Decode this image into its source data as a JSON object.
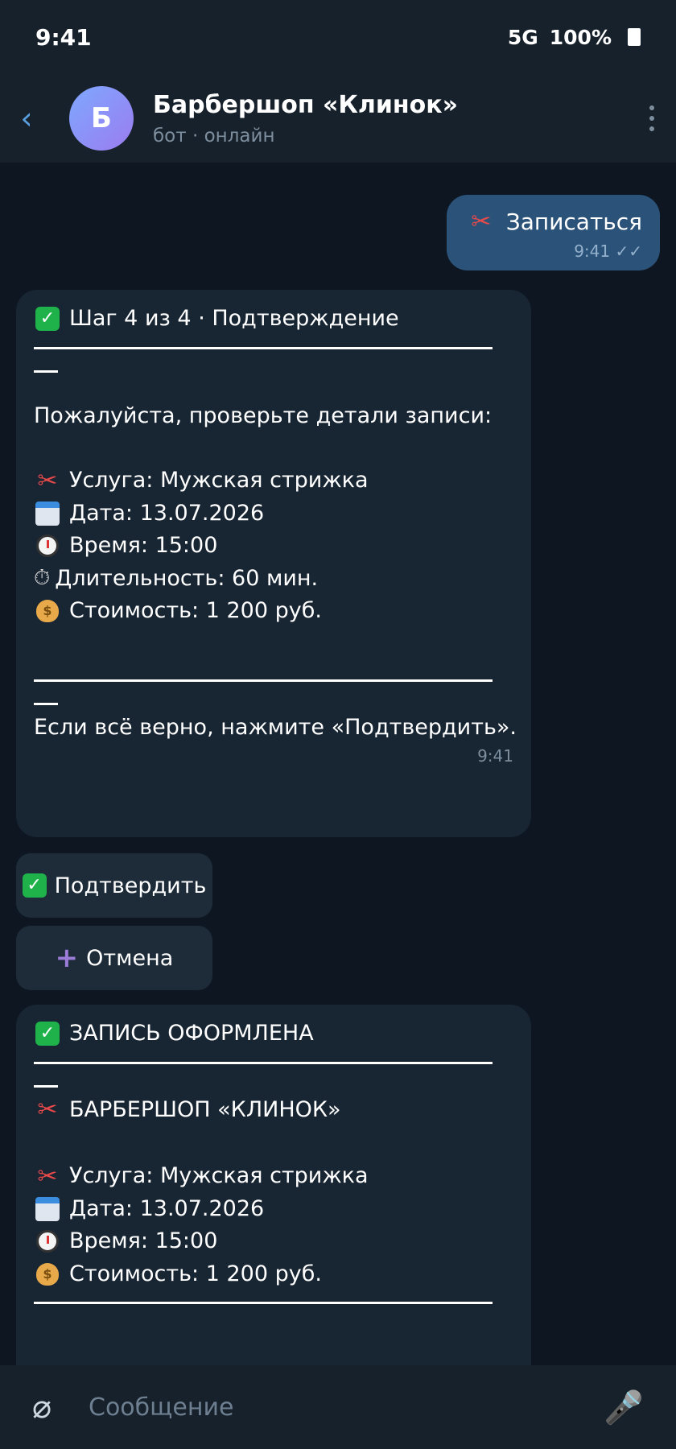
{
  "status_bar": {
    "time": "9:41",
    "network": "5G",
    "battery": "100%"
  },
  "header": {
    "avatar_letter": "Б",
    "title": "Барбершоп «Клинок»",
    "subtitle": "бот · онлайн"
  },
  "outgoing": {
    "text": "Записаться",
    "time": "9:41",
    "checks": "✓✓"
  },
  "confirm_message": {
    "title": "Шаг 4 из 4 · Подтверждение",
    "intro": "Пожалуйста, проверьте детали записи:",
    "service": "Услуга: Мужская стрижка",
    "date": "Дата: 13.07.2026",
    "time": "Время: 15:00",
    "duration": "Длительность: 60 мин.",
    "price": "Стоимость: 1 200 руб.",
    "footer": "Если всё верно, нажмите «Подтвердить».",
    "timestamp": "9:41"
  },
  "buttons": {
    "confirm": "Подтвердить",
    "cancel": "Отмена"
  },
  "booked_message": {
    "title": "ЗАПИСЬ ОФОРМЛЕНА",
    "shop": "БАРБЕРШОП «КЛИНОК»",
    "service": "Услуга: Мужская стрижка",
    "date": "Дата: 13.07.2026",
    "time": "Время: 15:00",
    "price": "Стоимость: 1 200 руб."
  },
  "input": {
    "placeholder": "Сообщение"
  }
}
